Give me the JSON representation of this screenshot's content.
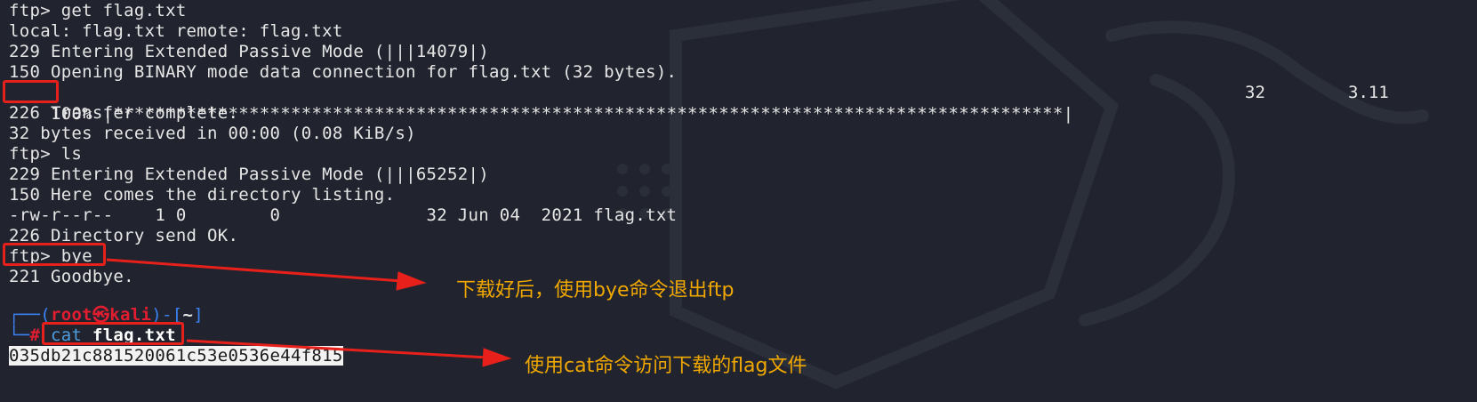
{
  "terminal": {
    "lines": [
      "ftp> get flag.txt",
      "local: flag.txt remote: flag.txt",
      "229 Entering Extended Passive Mode (|||14079|)",
      "150 Opening BINARY mode data connection for flag.txt (32 bytes).",
      "",
      "226 Transfer complete.",
      "32 bytes received in 00:00 (0.08 KiB/s)",
      "ftp> ls",
      "229 Entering Extended Passive Mode (|||65252|)",
      "150 Here comes the directory listing.",
      "-rw-r--r--    1 0        0              32 Jun 04  2021 flag.txt",
      "226 Directory send OK.",
      "ftp> bye",
      "221 Goodbye."
    ],
    "progress": {
      "percent": "100%",
      "bar": " |*******************************************************************************************|",
      "bytes": "32",
      "rate": "3.11"
    },
    "prompt": {
      "top_prefix": "┌──(",
      "user": "root",
      "at_symbol": "㉿",
      "host": "kali",
      "mid": ")-[",
      "dir": "~",
      "end": "]",
      "bottom_prefix": "└─",
      "hash": "#",
      "cmd_name": "cat",
      "cmd_arg": "flag.txt"
    },
    "output_hash": "035db21c881520061c53e0536e44f815"
  },
  "annotations": {
    "note1": "下载好后，使用bye命令退出ftp",
    "note2": "使用cat命令访问下载的flag文件"
  },
  "colors": {
    "background": "#21242e",
    "highlight_box": "#e8201b",
    "annotation_text": "#f0a800"
  }
}
